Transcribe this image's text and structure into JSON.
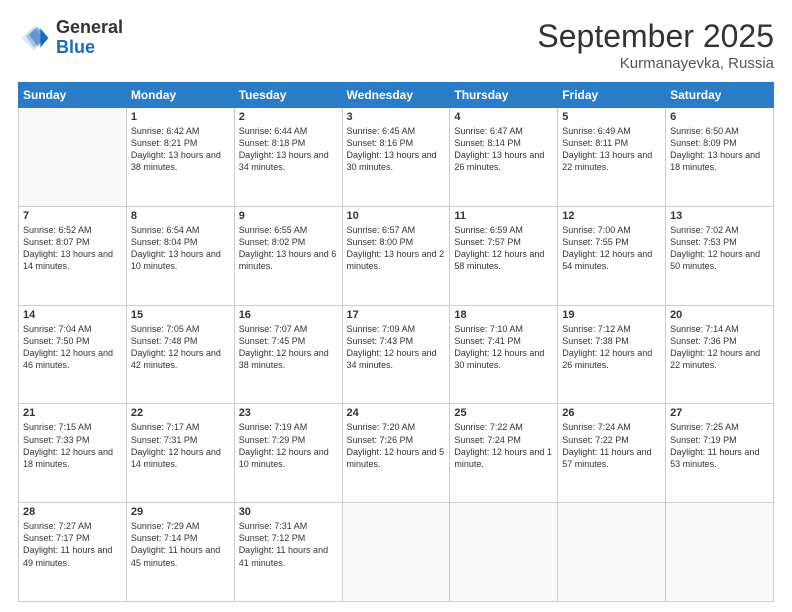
{
  "header": {
    "logo_general": "General",
    "logo_blue": "Blue",
    "month_title": "September 2025",
    "location": "Kurmanayevka, Russia"
  },
  "weekdays": [
    "Sunday",
    "Monday",
    "Tuesday",
    "Wednesday",
    "Thursday",
    "Friday",
    "Saturday"
  ],
  "weeks": [
    [
      {
        "day": "",
        "sunrise": "",
        "sunset": "",
        "daylight": ""
      },
      {
        "day": "1",
        "sunrise": "Sunrise: 6:42 AM",
        "sunset": "Sunset: 8:21 PM",
        "daylight": "Daylight: 13 hours and 38 minutes."
      },
      {
        "day": "2",
        "sunrise": "Sunrise: 6:44 AM",
        "sunset": "Sunset: 8:18 PM",
        "daylight": "Daylight: 13 hours and 34 minutes."
      },
      {
        "day": "3",
        "sunrise": "Sunrise: 6:45 AM",
        "sunset": "Sunset: 8:16 PM",
        "daylight": "Daylight: 13 hours and 30 minutes."
      },
      {
        "day": "4",
        "sunrise": "Sunrise: 6:47 AM",
        "sunset": "Sunset: 8:14 PM",
        "daylight": "Daylight: 13 hours and 26 minutes."
      },
      {
        "day": "5",
        "sunrise": "Sunrise: 6:49 AM",
        "sunset": "Sunset: 8:11 PM",
        "daylight": "Daylight: 13 hours and 22 minutes."
      },
      {
        "day": "6",
        "sunrise": "Sunrise: 6:50 AM",
        "sunset": "Sunset: 8:09 PM",
        "daylight": "Daylight: 13 hours and 18 minutes."
      }
    ],
    [
      {
        "day": "7",
        "sunrise": "Sunrise: 6:52 AM",
        "sunset": "Sunset: 8:07 PM",
        "daylight": "Daylight: 13 hours and 14 minutes."
      },
      {
        "day": "8",
        "sunrise": "Sunrise: 6:54 AM",
        "sunset": "Sunset: 8:04 PM",
        "daylight": "Daylight: 13 hours and 10 minutes."
      },
      {
        "day": "9",
        "sunrise": "Sunrise: 6:55 AM",
        "sunset": "Sunset: 8:02 PM",
        "daylight": "Daylight: 13 hours and 6 minutes."
      },
      {
        "day": "10",
        "sunrise": "Sunrise: 6:57 AM",
        "sunset": "Sunset: 8:00 PM",
        "daylight": "Daylight: 13 hours and 2 minutes."
      },
      {
        "day": "11",
        "sunrise": "Sunrise: 6:59 AM",
        "sunset": "Sunset: 7:57 PM",
        "daylight": "Daylight: 12 hours and 58 minutes."
      },
      {
        "day": "12",
        "sunrise": "Sunrise: 7:00 AM",
        "sunset": "Sunset: 7:55 PM",
        "daylight": "Daylight: 12 hours and 54 minutes."
      },
      {
        "day": "13",
        "sunrise": "Sunrise: 7:02 AM",
        "sunset": "Sunset: 7:53 PM",
        "daylight": "Daylight: 12 hours and 50 minutes."
      }
    ],
    [
      {
        "day": "14",
        "sunrise": "Sunrise: 7:04 AM",
        "sunset": "Sunset: 7:50 PM",
        "daylight": "Daylight: 12 hours and 46 minutes."
      },
      {
        "day": "15",
        "sunrise": "Sunrise: 7:05 AM",
        "sunset": "Sunset: 7:48 PM",
        "daylight": "Daylight: 12 hours and 42 minutes."
      },
      {
        "day": "16",
        "sunrise": "Sunrise: 7:07 AM",
        "sunset": "Sunset: 7:45 PM",
        "daylight": "Daylight: 12 hours and 38 minutes."
      },
      {
        "day": "17",
        "sunrise": "Sunrise: 7:09 AM",
        "sunset": "Sunset: 7:43 PM",
        "daylight": "Daylight: 12 hours and 34 minutes."
      },
      {
        "day": "18",
        "sunrise": "Sunrise: 7:10 AM",
        "sunset": "Sunset: 7:41 PM",
        "daylight": "Daylight: 12 hours and 30 minutes."
      },
      {
        "day": "19",
        "sunrise": "Sunrise: 7:12 AM",
        "sunset": "Sunset: 7:38 PM",
        "daylight": "Daylight: 12 hours and 26 minutes."
      },
      {
        "day": "20",
        "sunrise": "Sunrise: 7:14 AM",
        "sunset": "Sunset: 7:36 PM",
        "daylight": "Daylight: 12 hours and 22 minutes."
      }
    ],
    [
      {
        "day": "21",
        "sunrise": "Sunrise: 7:15 AM",
        "sunset": "Sunset: 7:33 PM",
        "daylight": "Daylight: 12 hours and 18 minutes."
      },
      {
        "day": "22",
        "sunrise": "Sunrise: 7:17 AM",
        "sunset": "Sunset: 7:31 PM",
        "daylight": "Daylight: 12 hours and 14 minutes."
      },
      {
        "day": "23",
        "sunrise": "Sunrise: 7:19 AM",
        "sunset": "Sunset: 7:29 PM",
        "daylight": "Daylight: 12 hours and 10 minutes."
      },
      {
        "day": "24",
        "sunrise": "Sunrise: 7:20 AM",
        "sunset": "Sunset: 7:26 PM",
        "daylight": "Daylight: 12 hours and 5 minutes."
      },
      {
        "day": "25",
        "sunrise": "Sunrise: 7:22 AM",
        "sunset": "Sunset: 7:24 PM",
        "daylight": "Daylight: 12 hours and 1 minute."
      },
      {
        "day": "26",
        "sunrise": "Sunrise: 7:24 AM",
        "sunset": "Sunset: 7:22 PM",
        "daylight": "Daylight: 11 hours and 57 minutes."
      },
      {
        "day": "27",
        "sunrise": "Sunrise: 7:25 AM",
        "sunset": "Sunset: 7:19 PM",
        "daylight": "Daylight: 11 hours and 53 minutes."
      }
    ],
    [
      {
        "day": "28",
        "sunrise": "Sunrise: 7:27 AM",
        "sunset": "Sunset: 7:17 PM",
        "daylight": "Daylight: 11 hours and 49 minutes."
      },
      {
        "day": "29",
        "sunrise": "Sunrise: 7:29 AM",
        "sunset": "Sunset: 7:14 PM",
        "daylight": "Daylight: 11 hours and 45 minutes."
      },
      {
        "day": "30",
        "sunrise": "Sunrise: 7:31 AM",
        "sunset": "Sunset: 7:12 PM",
        "daylight": "Daylight: 11 hours and 41 minutes."
      },
      {
        "day": "",
        "sunrise": "",
        "sunset": "",
        "daylight": ""
      },
      {
        "day": "",
        "sunrise": "",
        "sunset": "",
        "daylight": ""
      },
      {
        "day": "",
        "sunrise": "",
        "sunset": "",
        "daylight": ""
      },
      {
        "day": "",
        "sunrise": "",
        "sunset": "",
        "daylight": ""
      }
    ]
  ]
}
